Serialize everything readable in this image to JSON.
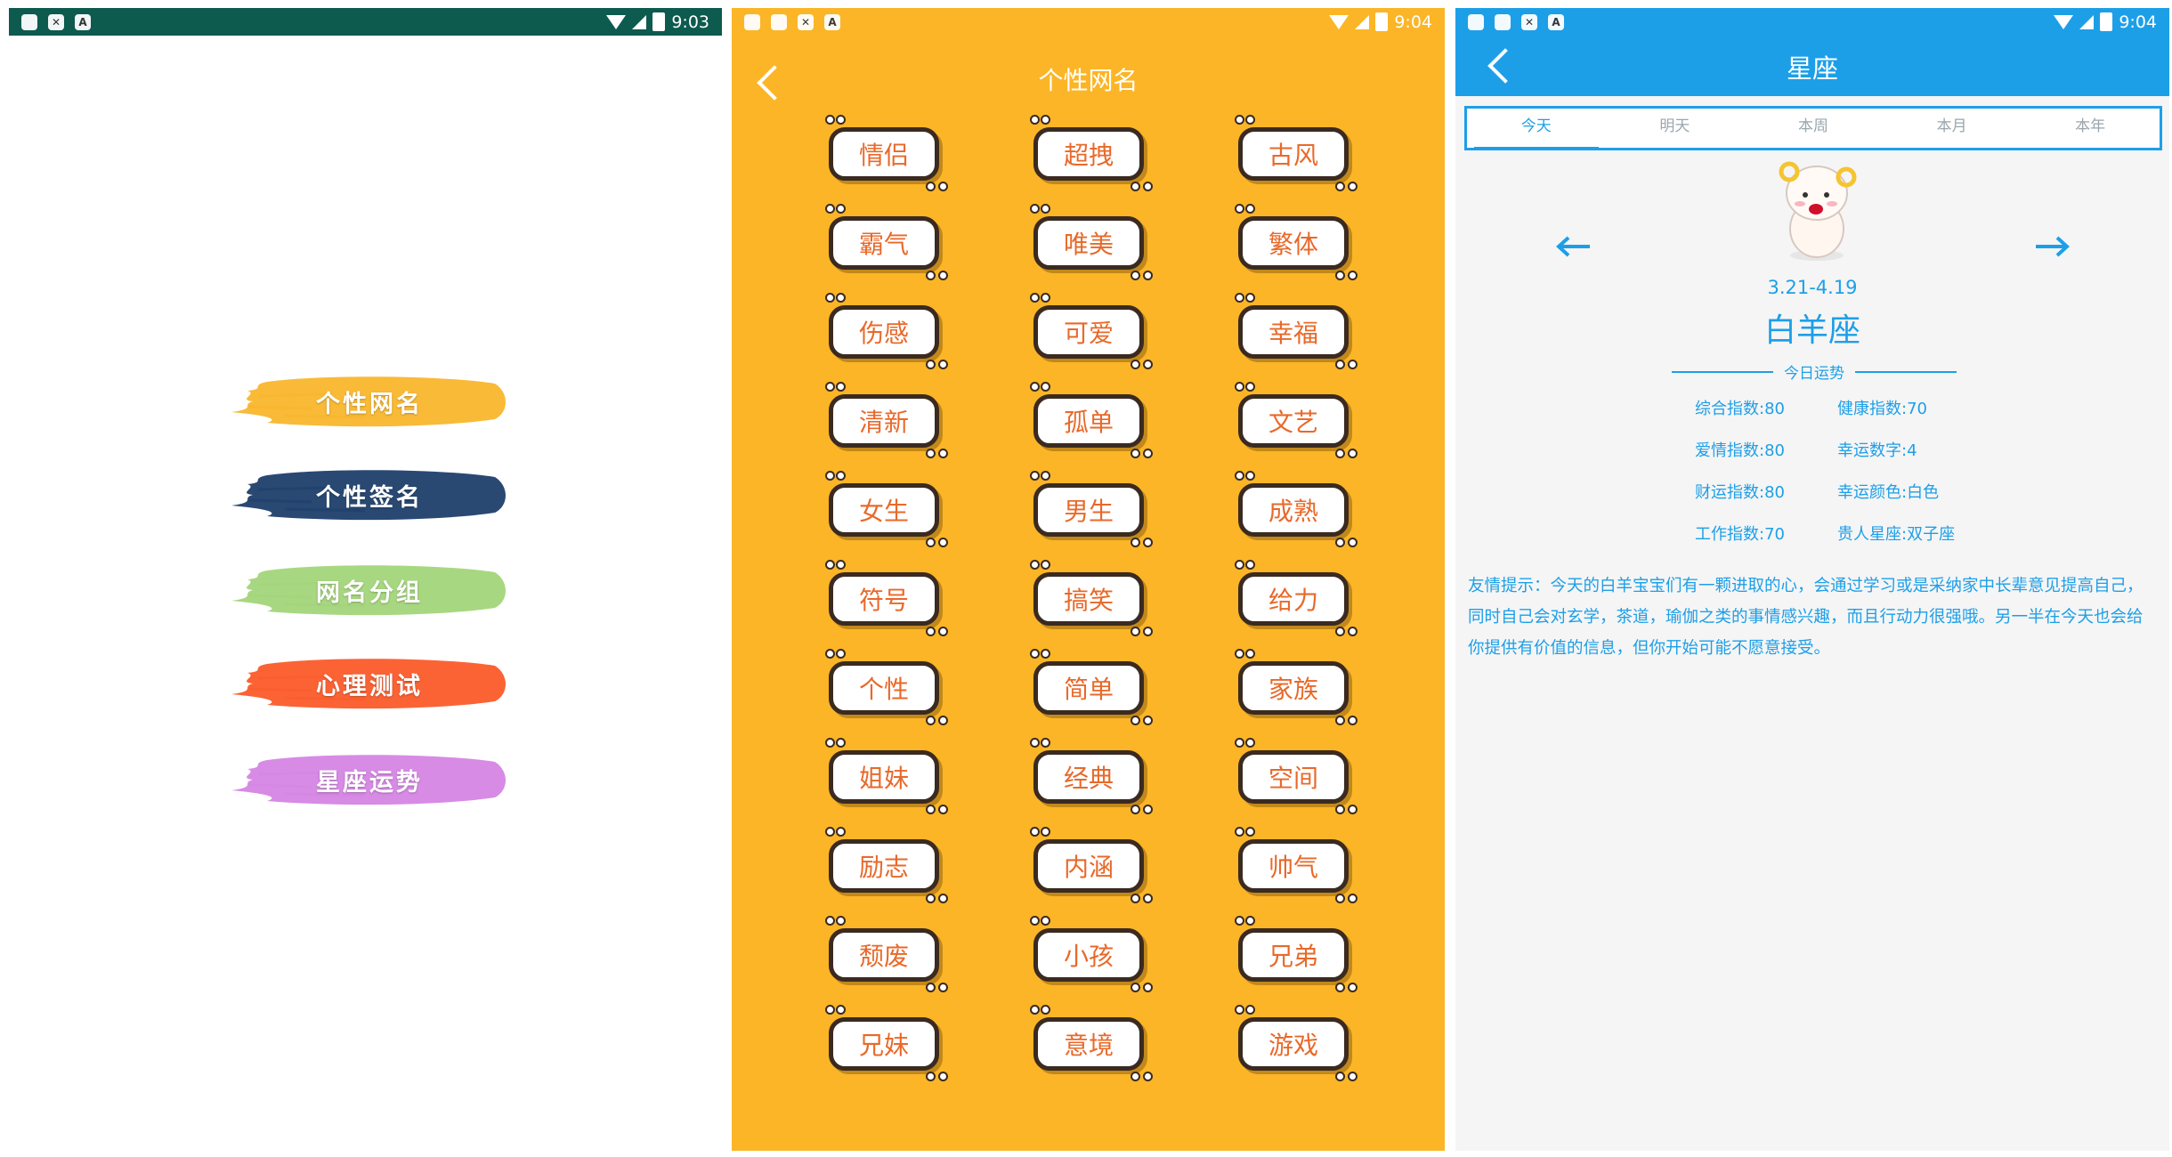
{
  "screen_home": {
    "status": {
      "time": "9:03",
      "left_icons": [
        "app-icon",
        "close-box-icon",
        "a-icon"
      ]
    },
    "menu": [
      {
        "label": "个性网名",
        "color": "#f9b62c"
      },
      {
        "label": "个性签名",
        "color": "#1d3f6b"
      },
      {
        "label": "网名分组",
        "color": "#a3d57a"
      },
      {
        "label": "心理测试",
        "color": "#fb5b2a"
      },
      {
        "label": "星座运势",
        "color": "#d585e4"
      }
    ]
  },
  "screen_names": {
    "status": {
      "time": "9:04",
      "left_icons": [
        "image-icon",
        "app-icon",
        "close-box-icon",
        "a-icon"
      ]
    },
    "title": "个性网名",
    "tags": [
      "情侣",
      "超拽",
      "古风",
      "霸气",
      "唯美",
      "繁体",
      "伤感",
      "可爱",
      "幸福",
      "清新",
      "孤单",
      "文艺",
      "女生",
      "男生",
      "成熟",
      "符号",
      "搞笑",
      "给力",
      "个性",
      "简单",
      "家族",
      "姐妹",
      "经典",
      "空间",
      "励志",
      "内涵",
      "帅气",
      "颓废",
      "小孩",
      "兄弟",
      "兄妹",
      "意境",
      "游戏"
    ],
    "colors": {
      "background": "#fbb526",
      "tag_text": "#e8692a"
    }
  },
  "screen_horoscope": {
    "status": {
      "time": "9:04",
      "left_icons": [
        "image-icon",
        "app-icon",
        "close-box-icon",
        "a-icon"
      ]
    },
    "title": "星座",
    "tabs": [
      {
        "label": "今天",
        "active": true
      },
      {
        "label": "明天",
        "active": false
      },
      {
        "label": "本周",
        "active": false
      },
      {
        "label": "本月",
        "active": false
      },
      {
        "label": "本年",
        "active": false
      }
    ],
    "date_range": "3.21-4.19",
    "sign_name": "白羊座",
    "today_label": "今日运势",
    "stats": [
      "综合指数:80",
      "健康指数:70",
      "爱情指数:80",
      "幸运数字:4",
      "财运指数:80",
      "幸运颜色:白色",
      "工作指数:70",
      "贵人星座:双子座"
    ],
    "tip": "友情提示：今天的白羊宝宝们有一颗进取的心，会通过学习或是采纳家中长辈意见提高自己，同时自己会对玄学，茶道，瑜伽之类的事情感兴趣，而且行动力很强哦。另一半在今天也会给你提供有价值的信息，但你开始可能不愿意接受。",
    "colors": {
      "accent": "#1d9fe8"
    }
  }
}
